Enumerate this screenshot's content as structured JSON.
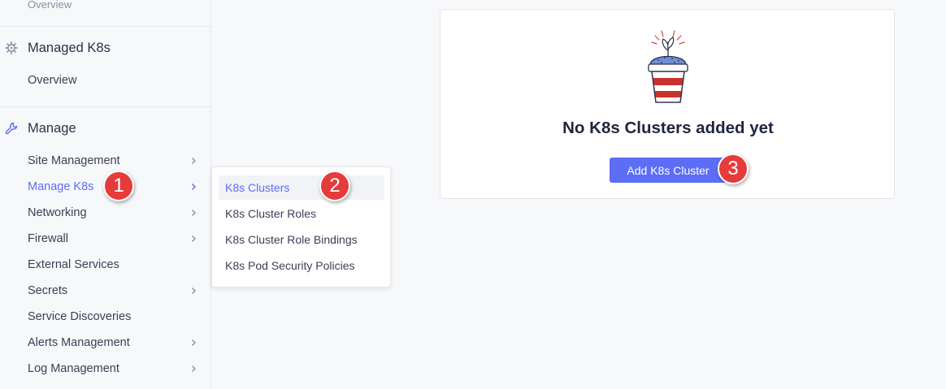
{
  "sidebar": {
    "top_item": "Overview",
    "sections": [
      {
        "title": "Managed K8s",
        "icon": "helm-wheel-icon",
        "items": [
          {
            "label": "Overview",
            "has_submenu": false
          }
        ]
      },
      {
        "title": "Manage",
        "icon": "wrench-icon",
        "items": [
          {
            "label": "Site Management",
            "has_submenu": true
          },
          {
            "label": "Manage K8s",
            "has_submenu": true,
            "active": true
          },
          {
            "label": "Networking",
            "has_submenu": true
          },
          {
            "label": "Firewall",
            "has_submenu": true
          },
          {
            "label": "External Services",
            "has_submenu": false
          },
          {
            "label": "Secrets",
            "has_submenu": true
          },
          {
            "label": "Service Discoveries",
            "has_submenu": false
          },
          {
            "label": "Alerts Management",
            "has_submenu": true
          },
          {
            "label": "Log Management",
            "has_submenu": true
          }
        ]
      }
    ]
  },
  "flyout": {
    "items": [
      {
        "label": "K8s Clusters",
        "active": true
      },
      {
        "label": "K8s Cluster Roles"
      },
      {
        "label": "K8s Cluster Role Bindings"
      },
      {
        "label": "K8s Pod Security Policies"
      }
    ]
  },
  "empty_state": {
    "title": "No K8s Clusters added yet",
    "button_label": "Add K8s Cluster",
    "illustration": "plant-pot-illustration"
  },
  "badges": [
    "1",
    "2",
    "3"
  ],
  "colors": {
    "accent": "#5b6ef5",
    "badge": "#e63b3b",
    "background": "#f7f8fa"
  }
}
